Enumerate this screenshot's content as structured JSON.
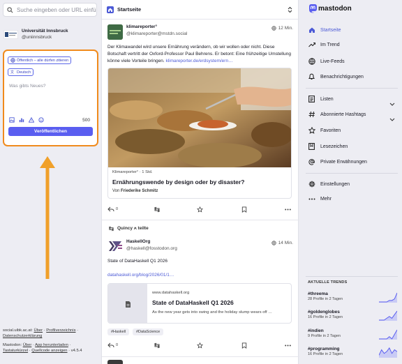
{
  "search": {
    "placeholder": "Suche eingeben oder URL einfü"
  },
  "account": {
    "name": "Universität Innsbruck",
    "handle": "@uniinnsbruck"
  },
  "compose": {
    "visibility": "Öffentlich – alle dürfen zitieren",
    "language": "Deutsch",
    "placeholder": "Was gibts Neues?",
    "char_count": "500",
    "publish_label": "Veröffentlichen"
  },
  "footer": {
    "server": "social.uibk.ac.at",
    "about": "Über",
    "directory": "Profilverzeichnis",
    "privacy": "Datenschutzerklärung",
    "mastodon": "Mastodon",
    "about2": "Über",
    "apps": "App herunterladen",
    "shortcuts": "Tastaturkürzel",
    "source": "Quellcode anzeigen",
    "version": "v4.5.4",
    "sep": "·",
    "colon": ":"
  },
  "column": {
    "title": "Startseite"
  },
  "post1": {
    "display_name": "klimareporter°",
    "handle": "@klimareporter@mstdn.social",
    "time": "12 Min.",
    "text": "Der Klimawandel wird unsere Ernährung verändern, ob wir wollen oder nicht. Diese Botschaft vertritt der Oxford-Professor Paul Behrens. Er betont: Eine frühzeitige Umstellung könne viele Vorteile bringen.",
    "link": "klimareporter.de/erdsystem/ern…",
    "card_source": "Klimareporter° · 1 Std.",
    "card_title": "Ernährungswende by design oder by disaster?",
    "card_author_prefix": "Von",
    "card_author": "Friederike Schmitz",
    "replies": "0",
    "avatar_label": "klima-\nreporter°"
  },
  "post2": {
    "boost_text": "Quincy ⍲ teilte",
    "display_name": "HaskellOrg",
    "handle": "@haskell@fosstodon.org",
    "time": "14 Min.",
    "text": "State of DataHaskell Q1 2026",
    "link": "datahaskell.org/blog/2026/01/1…",
    "card_domain": "www.datahaskell.org",
    "card_title": "State of DataHaskell Q1 2026",
    "card_desc": "As the new year gets into swing and the holiday slump wears off …",
    "tags": [
      "#Haskell",
      "#DataScience"
    ],
    "replies": "0"
  },
  "nav": {
    "logo": "mastodon",
    "items": [
      {
        "label": "Startseite"
      },
      {
        "label": "Im Trend"
      },
      {
        "label": "Live-Feeds"
      },
      {
        "label": "Benachrichtigungen"
      },
      {
        "label": "Listen"
      },
      {
        "label": "Abonnierte Hashtags"
      },
      {
        "label": "Favoriten"
      },
      {
        "label": "Lesezeichen"
      },
      {
        "label": "Private Erwähnungen"
      },
      {
        "label": "Einstellungen"
      },
      {
        "label": "Mehr"
      }
    ]
  },
  "trends": {
    "heading": "AKTUELLE TRENDS",
    "items": [
      {
        "tag": "#threema",
        "count": "28 Profile in 2 Tagen",
        "spark": [
          0,
          0,
          0,
          0,
          1,
          1,
          2,
          6
        ]
      },
      {
        "tag": "#goldenglobes",
        "count": "16 Profile in 2 Tagen",
        "spark": [
          0,
          0,
          0,
          1,
          2,
          1,
          3,
          5
        ]
      },
      {
        "tag": "#indien",
        "count": "9 Profile in 2 Tagen",
        "spark": [
          0,
          0,
          0,
          0,
          1,
          0,
          2,
          4
        ]
      },
      {
        "tag": "#programming",
        "count": "16 Profile in 2 Tagen",
        "spark": [
          1,
          4,
          2,
          3,
          5,
          2,
          4,
          3
        ]
      }
    ]
  },
  "colors": {
    "accent": "#5a5ef0",
    "highlight": "#f08a1c",
    "link": "#4c5ad6"
  },
  "icons": [
    "search-icon",
    "globe-icon",
    "language-icon",
    "image-icon",
    "poll-icon",
    "warning-icon",
    "emoji-icon",
    "home-icon",
    "trending-icon",
    "live-icon",
    "bell-icon",
    "list-icon",
    "hashtag-icon",
    "star-icon",
    "bookmark-icon",
    "at-icon",
    "gear-icon",
    "more-icon",
    "reply-icon",
    "boost-icon"
  ]
}
